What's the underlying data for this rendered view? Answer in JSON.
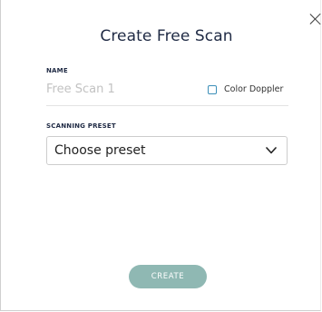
{
  "dialog": {
    "title": "Create Free Scan",
    "close_icon": "close-icon"
  },
  "name_field": {
    "label": "NAME",
    "value": "",
    "placeholder": "Free Scan 1"
  },
  "color_doppler": {
    "label": "Color Doppler",
    "checked": false
  },
  "scanning_preset": {
    "label": "SCANNING PRESET",
    "selected": "Choose preset",
    "icon": "chevron-down-icon"
  },
  "create_button": {
    "label": "CREATE"
  },
  "colors": {
    "title": "#1f2a44",
    "checkbox_border": "#3c8fb8",
    "button_bg": "#8fb8b3"
  }
}
